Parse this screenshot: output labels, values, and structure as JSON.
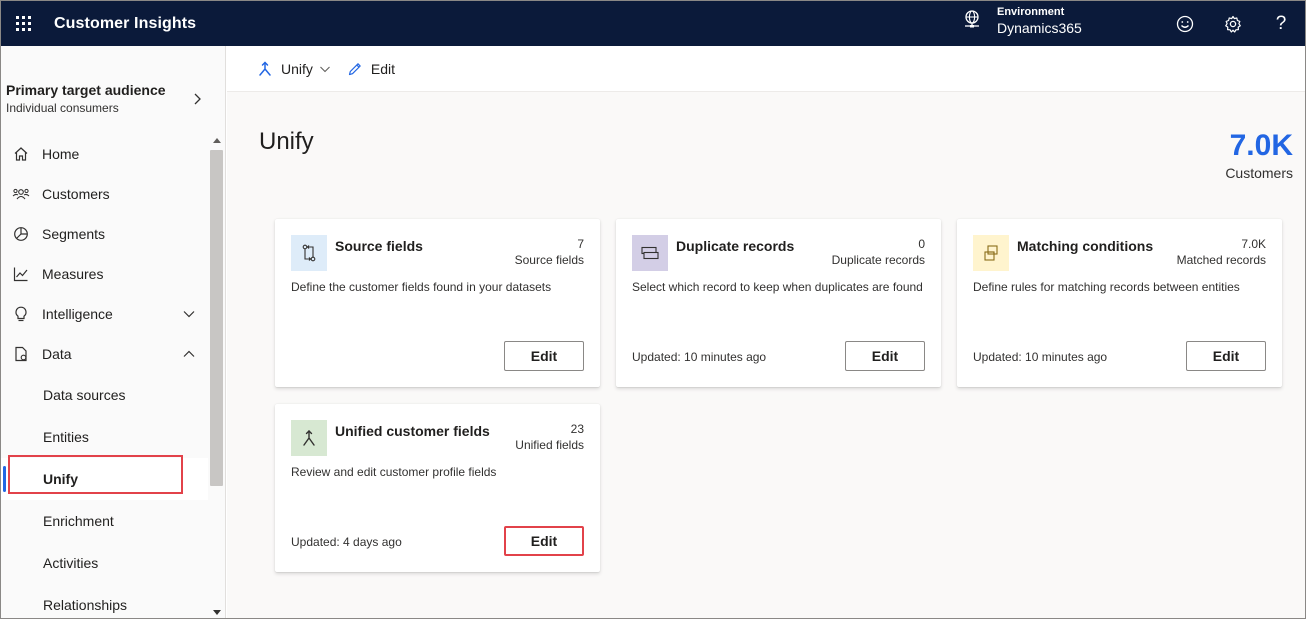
{
  "app": {
    "title": "Customer Insights"
  },
  "environment": {
    "label": "Environment",
    "value": "Dynamics365"
  },
  "top_icons": [
    "smiley-icon",
    "gear-icon",
    "help-icon"
  ],
  "help_glyph": "?",
  "audience": {
    "title": "Primary target audience",
    "subtitle": "Individual consumers"
  },
  "nav": {
    "home": "Home",
    "customers": "Customers",
    "segments": "Segments",
    "measures": "Measures",
    "intelligence": "Intelligence",
    "data": "Data",
    "sub": {
      "data_sources": "Data sources",
      "entities": "Entities",
      "unify": "Unify",
      "enrichment": "Enrichment",
      "activities": "Activities",
      "relationships": "Relationships"
    }
  },
  "command_bar": {
    "unify": "Unify",
    "edit": "Edit"
  },
  "page": {
    "title": "Unify",
    "kpi_value": "7.0K",
    "kpi_label": "Customers"
  },
  "cards": [
    {
      "title": "Source fields",
      "count": "7",
      "count_label": "Source fields",
      "description": "Define the customer fields found in your datasets",
      "updated": "",
      "button": "Edit",
      "icon": "source-fields-icon"
    },
    {
      "title": "Duplicate records",
      "count": "0",
      "count_label": "Duplicate records",
      "description": "Select which record to keep when duplicates are found",
      "updated": "Updated: 10 minutes ago",
      "button": "Edit",
      "icon": "duplicate-records-icon"
    },
    {
      "title": "Matching conditions",
      "count": "7.0K",
      "count_label": "Matched records",
      "description": "Define rules for matching records between entities",
      "updated": "Updated: 10 minutes ago",
      "button": "Edit",
      "icon": "matching-conditions-icon"
    },
    {
      "title": "Unified customer fields",
      "count": "23",
      "count_label": "Unified fields",
      "description": "Review and edit customer profile fields",
      "updated": "Updated: 4 days ago",
      "button": "Edit",
      "icon": "unify-merge-icon"
    }
  ],
  "colors": {
    "topbar": "#0b1a3a",
    "accent": "#2266e3",
    "highlight": "#e2424a"
  }
}
